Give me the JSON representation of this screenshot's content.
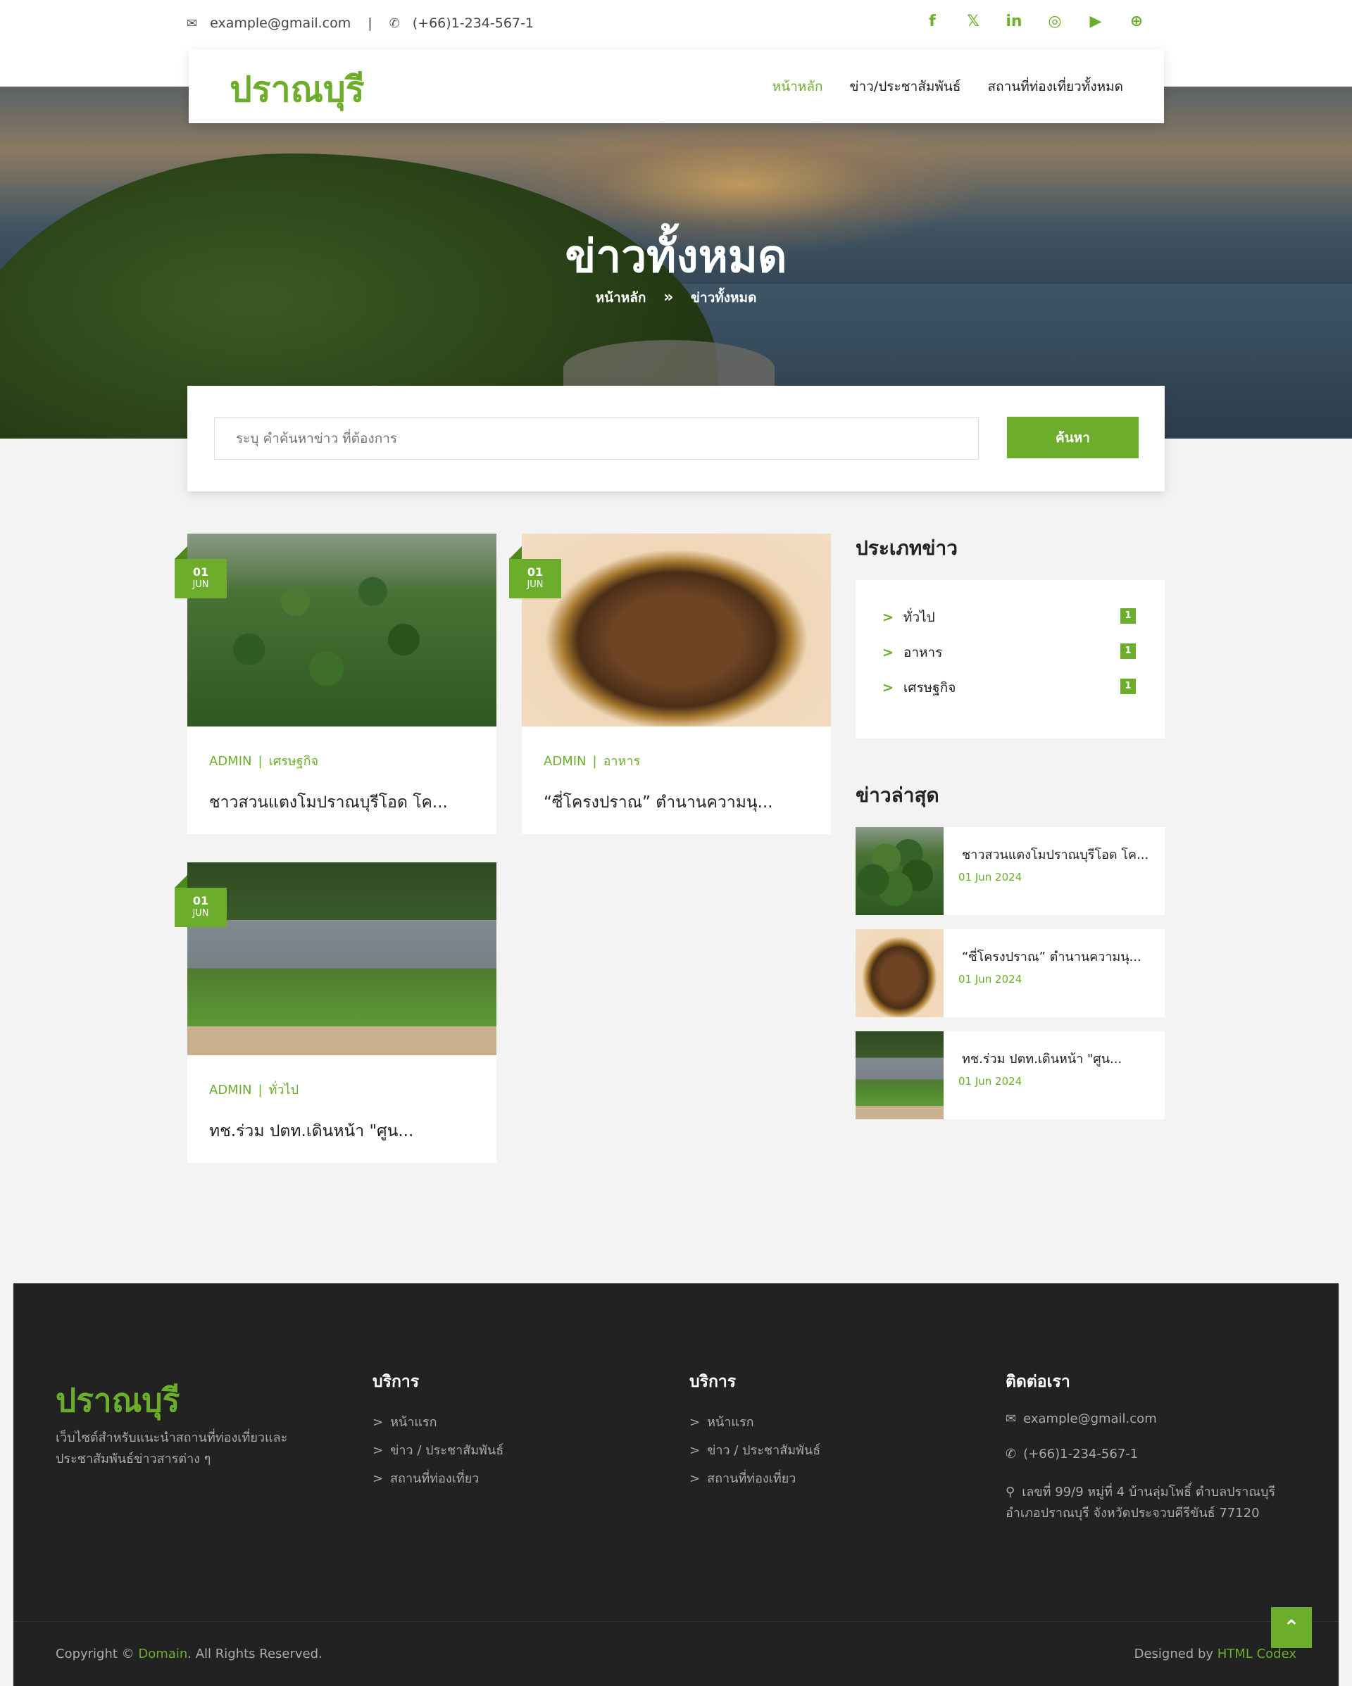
{
  "topbar": {
    "email": "example@gmail.com",
    "phone": "(+66)1-234-567-1",
    "social_icons": [
      "facebook-icon",
      "x-icon",
      "linkedin-icon",
      "instagram-icon",
      "youtube-icon",
      "globe-icon"
    ]
  },
  "header": {
    "logo": "ปราณบุรี",
    "nav": [
      "หน้าหลัก",
      "ข่าว/ประชาสัมพันธ์",
      "สถานที่ท่องเที่ยวทั้งหมด"
    ],
    "active_nav": "หน้าหลัก"
  },
  "hero": {
    "title": "ข่าวทั้งหมด",
    "breadcrumb": [
      "หน้าหลัก",
      "ข่าวทั้งหมด"
    ]
  },
  "search": {
    "placeholder": "ระบุ คำค้นหาข่าว ที่ต้องการ",
    "button": "ค้นหา"
  },
  "news": [
    {
      "day": "01",
      "month": "JUN",
      "author": "ADMIN",
      "category": "เศรษฐกิจ",
      "title": "ชาวสวนแตงโมปราณบุรีโอด โค...",
      "image": "watermelon"
    },
    {
      "day": "01",
      "month": "JUN",
      "author": "ADMIN",
      "category": "อาหาร",
      "title": "“ซี่โครงปราณ” ตำนานความนุ...",
      "image": "food"
    },
    {
      "day": "01",
      "month": "JUN",
      "author": "ADMIN",
      "category": "ทั่วไป",
      "title": "ทช.ร่วม ปตท.เดินหน้า \"ศูน...",
      "image": "park"
    }
  ],
  "sidebar": {
    "categories_title": "ประเภทข่าว",
    "categories": [
      {
        "label": "ทั่วไป",
        "count": "1"
      },
      {
        "label": "อาหาร",
        "count": "1"
      },
      {
        "label": "เศรษฐกิจ",
        "count": "1"
      }
    ],
    "latest_title": "ข่าวล่าสุด",
    "latest": [
      {
        "title": "ชาวสวนแตงโมปราณบุรีโอด โค...",
        "date": "01 Jun 2024"
      },
      {
        "title": "“ซี่โครงปราณ” ตำนานความนุ...",
        "date": "01 Jun 2024"
      },
      {
        "title": "ทช.ร่วม ปตท.เดินหน้า \"ศูน...",
        "date": "01 Jun 2024"
      }
    ]
  },
  "footer": {
    "logo": "ปราณบุรี",
    "description": "เว็บไซต์สำหรับแนะนำสถานที่ท่องเที่ยวและประชาสัมพันธ์ข่าวสารต่าง ๆ",
    "col1_title": "บริการ",
    "col1_links": [
      "หน้าแรก",
      "ข่าว / ประชาสัมพันธ์",
      "สถานที่ท่องเที่ยว"
    ],
    "col2_title": "บริการ",
    "col2_links": [
      "หน้าแรก",
      "ข่าว / ประชาสัมพันธ์",
      "สถานที่ท่องเที่ยว"
    ],
    "contact_title": "ติดต่อเรา",
    "contact_email": "example@gmail.com",
    "contact_phone": "(+66)1-234-567-1",
    "contact_address": "เลขที่ 99/9 หมู่ที่ 4 บ้านลุ่มโพธิ์ ตำบลปราณบุรี อำเภอปราณบุรี จังหวัดประจวบคีรีขันธ์ 77120",
    "copyright_prefix": "Copyright ©",
    "copyright_link": "Domain",
    "copyright_suffix": ". All Rights Reserved.",
    "designed_prefix": "Designed by",
    "designed_link": "HTML Codex"
  },
  "colors": {
    "accent": "#6cae2c",
    "footer_bg": "#222222"
  }
}
